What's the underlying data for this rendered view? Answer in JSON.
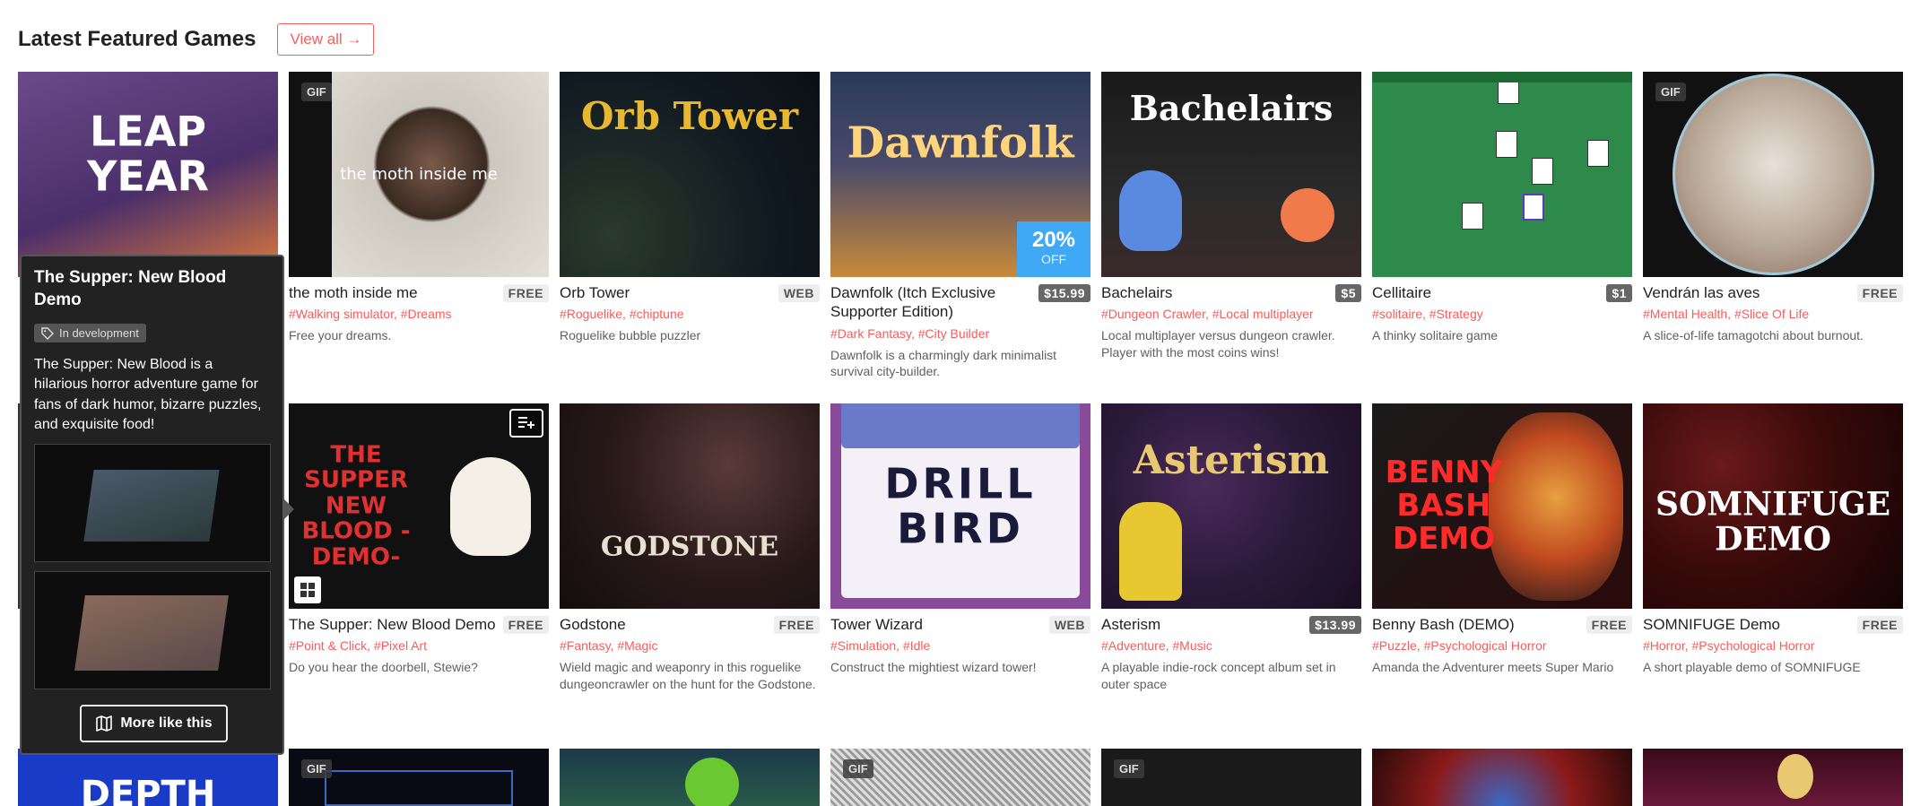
{
  "header": {
    "title": "Latest Featured Games",
    "view_all_label": "View all →"
  },
  "games": [
    {
      "title": "the moth inside me",
      "price": "FREE",
      "price_type": "free",
      "tags": "#Walking simulator, #Dreams",
      "desc": "Free your dreams.",
      "art_text": "the moth inside me",
      "gif": "GIF"
    },
    {
      "title": "Orb Tower",
      "price": "WEB",
      "price_type": "free",
      "tags": "#Roguelike, #chiptune",
      "desc": "Roguelike bubble puzzler",
      "art_text": "Orb Tower"
    },
    {
      "title": "Dawnfolk (Itch Exclusive Supporter Edition)",
      "price": "$15.99",
      "price_type": "paid",
      "tags": "#Dark Fantasy, #City Builder",
      "desc": "Dawnfolk is a charmingly dark minimalist survival city-builder.",
      "art_text": "Dawnfolk",
      "sale_pct": "20%",
      "sale_off": "OFF"
    },
    {
      "title": "Bachelairs",
      "price": "$5",
      "price_type": "paid",
      "tags": "#Dungeon Crawler, #Local multiplayer",
      "desc": "Local multiplayer versus dungeon crawler. Player with the most coins wins!",
      "art_text": "Bachelairs"
    },
    {
      "title": "Cellitaire",
      "price": "$1",
      "price_type": "paid",
      "tags": "#solitaire, #Strategy",
      "desc": "A thinky solitaire game",
      "art_text": ""
    },
    {
      "title": "Vendrán las aves",
      "price": "FREE",
      "price_type": "free",
      "tags": "#Mental Health, #Slice Of Life",
      "desc": "A slice-of-life tamagotchi about burnout.",
      "art_text": "",
      "gif": "GIF"
    },
    {
      "title": "The Supper: New Blood Demo",
      "price": "FREE",
      "price_type": "free",
      "tags": "#Point & Click, #Pixel Art",
      "desc": "Do you hear the doorbell, Stewie?",
      "art_text": "THE SUPPER NEW BLOOD -DEMO-"
    },
    {
      "title": "Godstone",
      "price": "FREE",
      "price_type": "free",
      "tags": "#Fantasy, #Magic",
      "desc": "Wield magic and weaponry in this roguelike dungeoncrawler on the hunt for the Godstone.",
      "art_text": "GODSTONE"
    },
    {
      "title": "Tower Wizard",
      "price": "WEB",
      "price_type": "free",
      "tags": "#Simulation, #Idle",
      "desc": "Construct the mightiest wizard tower!",
      "art_text": "DRILL BIRD"
    },
    {
      "title": "Asterism",
      "price": "$13.99",
      "price_type": "paid",
      "tags": "#Adventure, #Music",
      "desc": "A playable indie-rock concept album set in outer space",
      "art_text": "Asterism"
    },
    {
      "title": "Benny Bash (DEMO)",
      "price": "FREE",
      "price_type": "free",
      "tags": "#Puzzle, #Psychological Horror",
      "desc": "Amanda the Adventurer meets Super Mario",
      "art_text": "BENNY BASH DEMO"
    },
    {
      "title": "SOMNIFUGE Demo",
      "price": "FREE",
      "price_type": "free",
      "tags": "#Horror, #Psychological Horror",
      "desc": "A short playable demo of SOMNIFUGE",
      "art_text": "SOMNIFUGE DEMO"
    }
  ],
  "first_column": {
    "art_text": "LEAP YEAR"
  },
  "third_row": [
    {
      "art_text": "DEPTH"
    },
    {
      "gif": "GIF"
    },
    {
      "art_text": ""
    },
    {
      "gif": "GIF"
    },
    {
      "gif": "GIF"
    },
    {
      "art_text": ""
    },
    {
      "art_text": ""
    }
  ],
  "popup": {
    "title": "The Supper: New Blood Demo",
    "status": "In development",
    "desc": "The Supper: New Blood is a hilarious horror adventure game for fans of dark humor, bizarre puzzles, and exquisite food!",
    "more_label": "More like this"
  },
  "colors": {
    "accent": "#fa5c5c",
    "sale": "#3fa9f5"
  }
}
